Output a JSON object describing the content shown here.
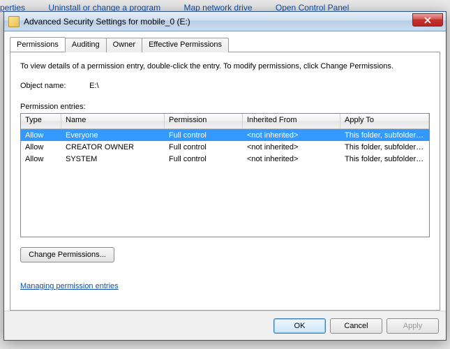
{
  "background_links": [
    "perties",
    "Uninstall or change a program",
    "Map network drive",
    "Open Control Panel"
  ],
  "dialog": {
    "title": "Advanced Security Settings for mobile_0 (E:)",
    "tabs": [
      "Permissions",
      "Auditing",
      "Owner",
      "Effective Permissions"
    ],
    "active_tab": 0,
    "instruction": "To view details of a permission entry, double-click the entry. To modify permissions, click Change Permissions.",
    "object_name_label": "Object name:",
    "object_name_value": "E:\\",
    "pe_label": "Permission entries:",
    "columns": [
      "Type",
      "Name",
      "Permission",
      "Inherited From",
      "Apply To"
    ],
    "rows": [
      {
        "type": "Allow",
        "name": "Everyone",
        "perm": "Full control",
        "inh": "<not inherited>",
        "apply": "This folder, subfolders and...",
        "selected": true
      },
      {
        "type": "Allow",
        "name": "CREATOR OWNER",
        "perm": "Full control",
        "inh": "<not inherited>",
        "apply": "This folder, subfolders and...",
        "selected": false
      },
      {
        "type": "Allow",
        "name": "SYSTEM",
        "perm": "Full control",
        "inh": "<not inherited>",
        "apply": "This folder, subfolders and...",
        "selected": false
      }
    ],
    "change_btn": "Change Permissions...",
    "help_link": "Managing permission entries",
    "buttons": {
      "ok": "OK",
      "cancel": "Cancel",
      "apply": "Apply"
    }
  }
}
